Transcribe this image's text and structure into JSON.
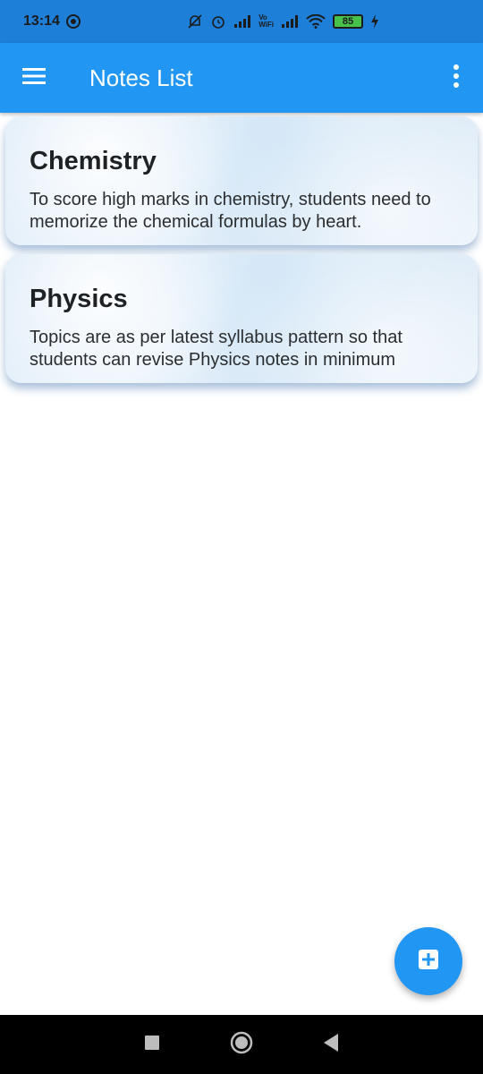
{
  "status_bar": {
    "time": "13:14",
    "battery": "85",
    "vowifi_top": "Vo",
    "vowifi_bottom": "WiFi"
  },
  "app_bar": {
    "title": "Notes List"
  },
  "notes": [
    {
      "title": "Chemistry",
      "body": "To score high marks in chemistry, students need to memorize the chemical formulas by heart."
    },
    {
      "title": "Physics",
      "body": "Topics are as per latest syllabus pattern so that students can revise Physics notes in minimum"
    }
  ],
  "icons": {
    "menu": "menu-icon",
    "more": "more-vert-icon",
    "fab": "add-box-icon"
  },
  "colors": {
    "primary": "#2196f3",
    "status_bar": "#1e7fd9"
  }
}
